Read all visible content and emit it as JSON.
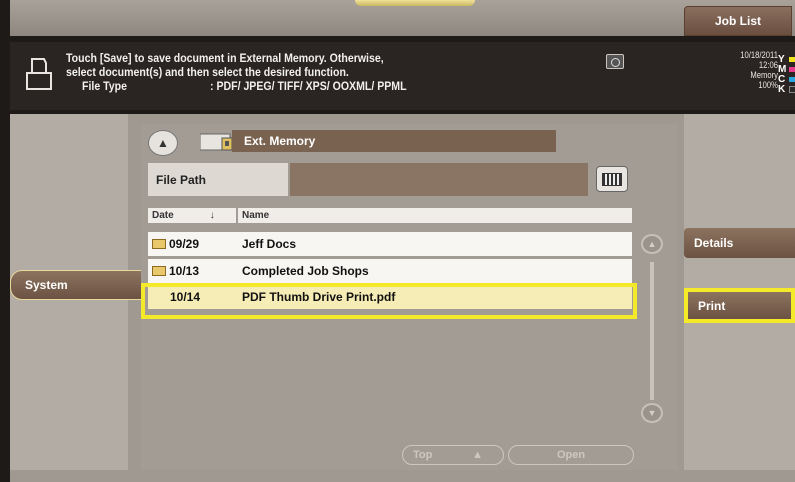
{
  "header": {
    "job_list_label": "Job List"
  },
  "message": {
    "line1": "Touch [Save] to save document in External Memory. Otherwise,",
    "line2": "select document(s) and then select the desired function.",
    "file_type_label": "File Type",
    "file_type_value": ": PDF/ JPEG/ TIFF/ XPS/ OOXML/ PPML"
  },
  "status": {
    "date": "10/18/2011",
    "time": "12:06",
    "memory_label": "Memory",
    "memory_value": "100%",
    "toner": [
      {
        "letter": "Y",
        "color": "#f2e21a"
      },
      {
        "letter": "M",
        "color": "#e83a8c"
      },
      {
        "letter": "C",
        "color": "#2aa6e0"
      },
      {
        "letter": "K",
        "color": "#2a2a2a"
      }
    ]
  },
  "left_nav": {
    "system_label": "System"
  },
  "location": {
    "memory_label": "Ext. Memory"
  },
  "file_path": {
    "label": "File Path",
    "value": ""
  },
  "table": {
    "col_date": "Date",
    "sort_arrow": "↓",
    "col_name": "Name",
    "rows": [
      {
        "date": "09/29",
        "name": "Jeff Docs",
        "type": "folder"
      },
      {
        "date": "10/13",
        "name": "Completed Job Shops",
        "type": "folder"
      },
      {
        "date": "10/14",
        "name": "PDF Thumb Drive Print.pdf",
        "type": "file"
      }
    ]
  },
  "bottom": {
    "top_label": "Top",
    "open_label": "Open"
  },
  "right_nav": {
    "details_label": "Details",
    "print_label": "Print"
  }
}
